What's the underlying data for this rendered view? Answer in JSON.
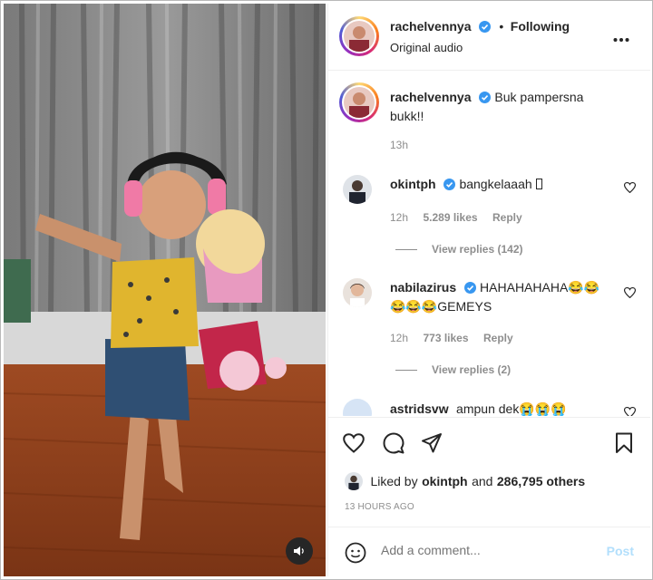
{
  "post": {
    "username": "rachelvennya",
    "follow_state": "Following",
    "separator": "•",
    "audio": "Original audio",
    "caption": "Buk pampersna bukk!!",
    "caption_time": "13h"
  },
  "comments": [
    {
      "username": "okintph",
      "text": "bangkelaaah ",
      "time": "12h",
      "likes": "5.289 likes",
      "reply": "Reply",
      "view_replies": "View replies (142)"
    },
    {
      "username": "nabilazirus",
      "text": "HAHAHAHAHA😂😂",
      "text_line2": "😂😂😂GEMEYS",
      "time": "12h",
      "likes": "773 likes",
      "reply": "Reply",
      "view_replies": "View replies (2)"
    },
    {
      "username": "astridsvw",
      "text": "ampun dek😭😭😭"
    }
  ],
  "likes": {
    "prefix": "Liked by",
    "user": "okintph",
    "joiner": "and",
    "others": "286,795 others"
  },
  "timestamp": "13 HOURS AGO",
  "add_comment": {
    "placeholder": "Add a comment...",
    "post_label": "Post"
  },
  "colors": {
    "verified": "#3897f0",
    "post_button": "#b2dffc",
    "muted_text": "#8e8e8e"
  },
  "icons": [
    "more-options-icon",
    "verified-badge-icon",
    "heart-icon",
    "comment-icon",
    "share-icon",
    "bookmark-icon",
    "emoji-icon",
    "sound-icon"
  ]
}
